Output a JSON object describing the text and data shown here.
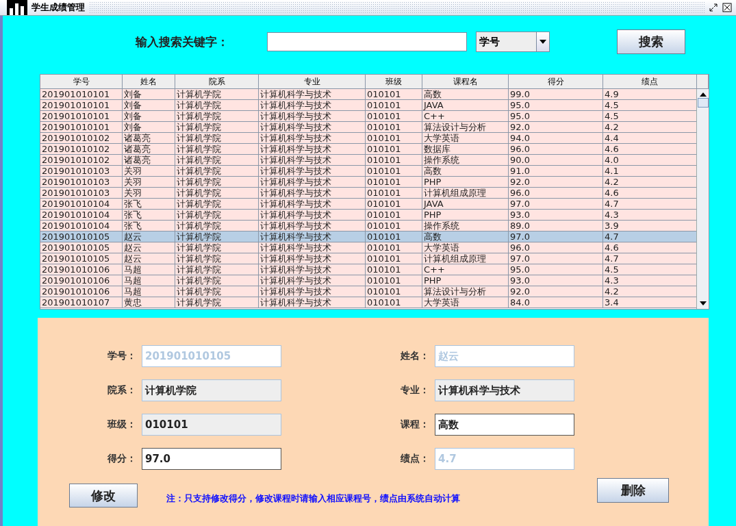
{
  "window": {
    "title": "学生成绩管理"
  },
  "search": {
    "label": "输入搜索关键字：",
    "dropdown": "学号",
    "button": "搜索"
  },
  "table": {
    "columns": [
      "学号",
      "姓名",
      "院系",
      "专业",
      "班级",
      "课程名",
      "得分",
      "绩点"
    ],
    "rows": [
      {
        "cells": [
          "201901010101",
          "刘备",
          "计算机学院",
          "计算机科学与技术",
          "010101",
          "高数",
          "99.0",
          "4.9"
        ],
        "selected": false
      },
      {
        "cells": [
          "201901010101",
          "刘备",
          "计算机学院",
          "计算机科学与技术",
          "010101",
          "JAVA",
          "95.0",
          "4.5"
        ],
        "selected": false
      },
      {
        "cells": [
          "201901010101",
          "刘备",
          "计算机学院",
          "计算机科学与技术",
          "010101",
          "C++",
          "95.0",
          "4.5"
        ],
        "selected": false
      },
      {
        "cells": [
          "201901010101",
          "刘备",
          "计算机学院",
          "计算机科学与技术",
          "010101",
          "算法设计与分析",
          "92.0",
          "4.2"
        ],
        "selected": false
      },
      {
        "cells": [
          "201901010102",
          "诸葛亮",
          "计算机学院",
          "计算机科学与技术",
          "010101",
          "大学英语",
          "94.0",
          "4.4"
        ],
        "selected": false
      },
      {
        "cells": [
          "201901010102",
          "诸葛亮",
          "计算机学院",
          "计算机科学与技术",
          "010101",
          "数据库",
          "96.0",
          "4.6"
        ],
        "selected": false
      },
      {
        "cells": [
          "201901010102",
          "诸葛亮",
          "计算机学院",
          "计算机科学与技术",
          "010101",
          "操作系统",
          "90.0",
          "4.0"
        ],
        "selected": false
      },
      {
        "cells": [
          "201901010103",
          "关羽",
          "计算机学院",
          "计算机科学与技术",
          "010101",
          "高数",
          "91.0",
          "4.1"
        ],
        "selected": false
      },
      {
        "cells": [
          "201901010103",
          "关羽",
          "计算机学院",
          "计算机科学与技术",
          "010101",
          "PHP",
          "92.0",
          "4.2"
        ],
        "selected": false
      },
      {
        "cells": [
          "201901010103",
          "关羽",
          "计算机学院",
          "计算机科学与技术",
          "010101",
          "计算机组成原理",
          "96.0",
          "4.6"
        ],
        "selected": false
      },
      {
        "cells": [
          "201901010104",
          "张飞",
          "计算机学院",
          "计算机科学与技术",
          "010101",
          "JAVA",
          "97.0",
          "4.7"
        ],
        "selected": false
      },
      {
        "cells": [
          "201901010104",
          "张飞",
          "计算机学院",
          "计算机科学与技术",
          "010101",
          "PHP",
          "93.0",
          "4.3"
        ],
        "selected": false
      },
      {
        "cells": [
          "201901010104",
          "张飞",
          "计算机学院",
          "计算机科学与技术",
          "010101",
          "操作系统",
          "89.0",
          "3.9"
        ],
        "selected": false
      },
      {
        "cells": [
          "201901010105",
          "赵云",
          "计算机学院",
          "计算机科学与技术",
          "010101",
          "高数",
          "97.0",
          "4.7"
        ],
        "selected": true
      },
      {
        "cells": [
          "201901010105",
          "赵云",
          "计算机学院",
          "计算机科学与技术",
          "010101",
          "大学英语",
          "96.0",
          "4.6"
        ],
        "selected": false
      },
      {
        "cells": [
          "201901010105",
          "赵云",
          "计算机学院",
          "计算机科学与技术",
          "010101",
          "计算机组成原理",
          "97.0",
          "4.7"
        ],
        "selected": false
      },
      {
        "cells": [
          "201901010106",
          "马超",
          "计算机学院",
          "计算机科学与技术",
          "010101",
          "C++",
          "95.0",
          "4.5"
        ],
        "selected": false
      },
      {
        "cells": [
          "201901010106",
          "马超",
          "计算机学院",
          "计算机科学与技术",
          "010101",
          "PHP",
          "93.0",
          "4.3"
        ],
        "selected": false
      },
      {
        "cells": [
          "201901010106",
          "马超",
          "计算机学院",
          "计算机科学与技术",
          "010101",
          "算法设计与分析",
          "92.0",
          "4.2"
        ],
        "selected": false
      },
      {
        "cells": [
          "201901010107",
          "黄忠",
          "计算机学院",
          "计算机科学与技术",
          "010101",
          "大学英语",
          "84.0",
          "3.4"
        ],
        "selected": false
      }
    ]
  },
  "form": {
    "fields": [
      {
        "label": "学号：",
        "value": "201901010105",
        "kind": "disabled"
      },
      {
        "label": "姓名：",
        "value": "赵云",
        "kind": "disabled"
      },
      {
        "label": "院系：",
        "value": "计算机学院",
        "kind": "readonly"
      },
      {
        "label": "专业：",
        "value": "计算机科学与技术",
        "kind": "readonly"
      },
      {
        "label": "班级：",
        "value": "010101",
        "kind": "readonly"
      },
      {
        "label": "课程：",
        "value": "高数",
        "kind": "editable"
      },
      {
        "label": "得分：",
        "value": "97.0",
        "kind": "editable"
      },
      {
        "label": "绩点：",
        "value": "4.7",
        "kind": "disabled"
      }
    ],
    "modify_button": "修改",
    "note": "注：只支持修改得分，修改课程时请输入相应课程号，绩点由系统自动计算",
    "delete_button": "删除"
  }
}
